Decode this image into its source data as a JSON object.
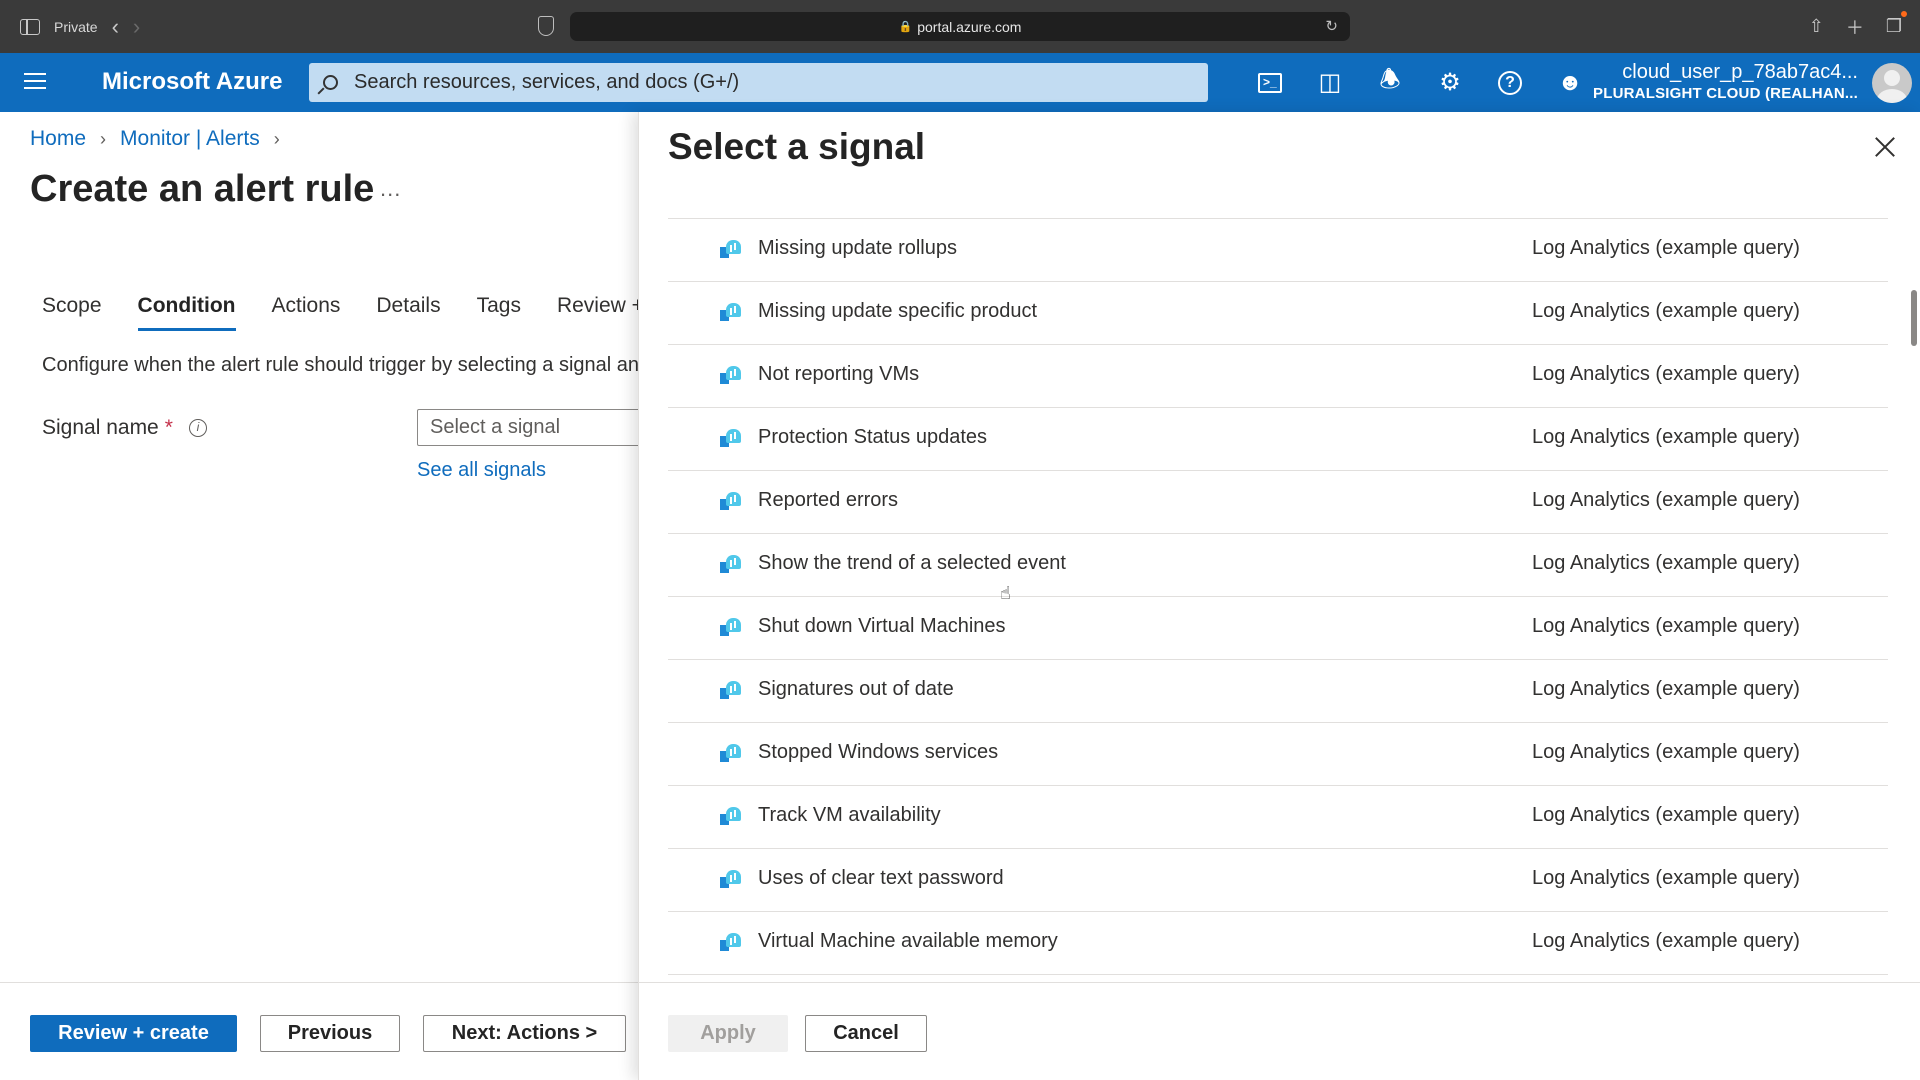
{
  "browser": {
    "private_label": "Private",
    "url": "portal.azure.com"
  },
  "header": {
    "brand": "Microsoft Azure",
    "search_placeholder": "Search resources, services, and docs (G+/)",
    "icons": [
      "cloud-shell-icon",
      "directory-filter-icon",
      "notifications-icon",
      "settings-icon",
      "help-icon",
      "feedback-icon"
    ],
    "user_name": "cloud_user_p_78ab7ac4...",
    "user_tenant": "PLURALSIGHT CLOUD (REALHAN..."
  },
  "breadcrumb": {
    "home": "Home",
    "monitor_alerts": "Monitor | Alerts"
  },
  "page": {
    "title": "Create an alert rule",
    "more": "...",
    "tabs": [
      {
        "label": "Scope",
        "active": false
      },
      {
        "label": "Condition",
        "active": true
      },
      {
        "label": "Actions",
        "active": false
      },
      {
        "label": "Details",
        "active": false
      },
      {
        "label": "Tags",
        "active": false
      },
      {
        "label": "Review +",
        "active": false
      }
    ],
    "condition_description": "Configure when the alert rule should trigger by selecting a signal an",
    "signal_name_label": "Signal name",
    "required_mark": "*",
    "signal_select_placeholder": "Select a signal",
    "see_all_signals": "See all signals"
  },
  "footer": {
    "review_create": "Review + create",
    "previous": "Previous",
    "next_actions": "Next: Actions >"
  },
  "blade": {
    "title": "Select a signal",
    "signals": [
      {
        "name": "Missing update rollups",
        "type": "Log Analytics (example query)"
      },
      {
        "name": "Missing update specific product",
        "type": "Log Analytics (example query)"
      },
      {
        "name": "Not reporting VMs",
        "type": "Log Analytics (example query)"
      },
      {
        "name": "Protection Status updates",
        "type": "Log Analytics (example query)"
      },
      {
        "name": "Reported errors",
        "type": "Log Analytics (example query)"
      },
      {
        "name": "Show the trend of a selected event",
        "type": "Log Analytics (example query)"
      },
      {
        "name": "Shut down Virtual Machines",
        "type": "Log Analytics (example query)"
      },
      {
        "name": "Signatures out of date",
        "type": "Log Analytics (example query)"
      },
      {
        "name": "Stopped Windows services",
        "type": "Log Analytics (example query)"
      },
      {
        "name": "Track VM availability",
        "type": "Log Analytics (example query)"
      },
      {
        "name": "Uses of clear text password",
        "type": "Log Analytics (example query)"
      },
      {
        "name": "Virtual Machine available memory",
        "type": "Log Analytics (example query)"
      }
    ],
    "apply": "Apply",
    "cancel": "Cancel"
  },
  "colors": {
    "azure_blue": "#0f6cbd",
    "search_bg": "#c2dcf2",
    "browser_chrome": "#3a3a3a"
  }
}
